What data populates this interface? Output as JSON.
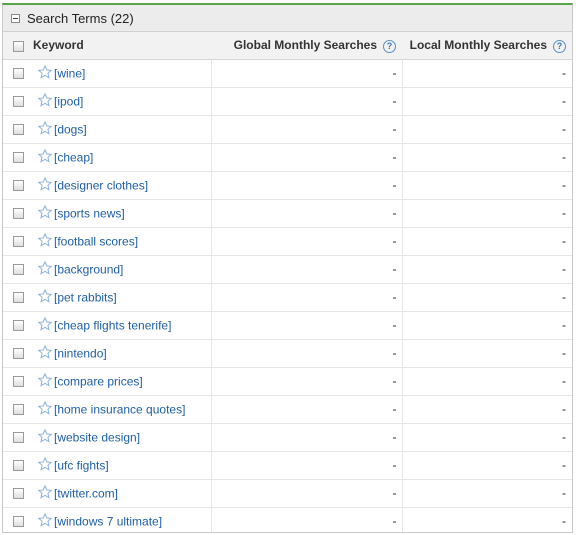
{
  "panel": {
    "title": "Search Terms (22)"
  },
  "columns": {
    "keyword": "Keyword",
    "global": "Global Monthly Searches",
    "local": "Local Monthly Searches",
    "help_glyph": "?"
  },
  "rows": [
    {
      "keyword": "[wine]",
      "global": "-",
      "local": "-"
    },
    {
      "keyword": "[ipod]",
      "global": "-",
      "local": "-"
    },
    {
      "keyword": "[dogs]",
      "global": "-",
      "local": "-"
    },
    {
      "keyword": "[cheap]",
      "global": "-",
      "local": "-"
    },
    {
      "keyword": "[designer clothes]",
      "global": "-",
      "local": "-"
    },
    {
      "keyword": "[sports news]",
      "global": "-",
      "local": "-"
    },
    {
      "keyword": "[football scores]",
      "global": "-",
      "local": "-"
    },
    {
      "keyword": "[background]",
      "global": "-",
      "local": "-"
    },
    {
      "keyword": "[pet rabbits]",
      "global": "-",
      "local": "-"
    },
    {
      "keyword": "[cheap flights tenerife]",
      "global": "-",
      "local": "-"
    },
    {
      "keyword": "[nintendo]",
      "global": "-",
      "local": "-"
    },
    {
      "keyword": "[compare prices]",
      "global": "-",
      "local": "-"
    },
    {
      "keyword": "[home insurance quotes]",
      "global": "-",
      "local": "-"
    },
    {
      "keyword": "[website design]",
      "global": "-",
      "local": "-"
    },
    {
      "keyword": "[ufc fights]",
      "global": "-",
      "local": "-"
    },
    {
      "keyword": "[twitter.com]",
      "global": "-",
      "local": "-"
    },
    {
      "keyword": "[windows 7 ultimate]",
      "global": "-",
      "local": "-"
    }
  ],
  "colors": {
    "accent": "#5aa34a",
    "link": "#1f5fa6",
    "help": "#3b78c0"
  }
}
